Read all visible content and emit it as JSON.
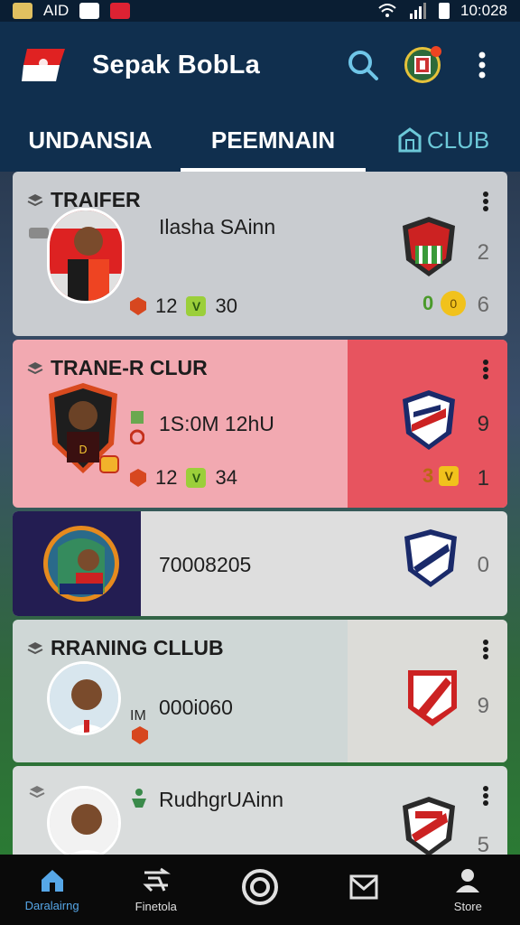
{
  "status_bar": {
    "carrier": "AID",
    "time": "10:028"
  },
  "app_bar": {
    "title": "Sepak BobLa"
  },
  "tabs": [
    {
      "label": "UNDANSIA",
      "active": false
    },
    {
      "label": "PEEMNAIN",
      "active": true
    },
    {
      "label": "CLUB",
      "active": false
    }
  ],
  "cards": [
    {
      "section": "TRAIFER",
      "player_name": "Ilasha SAinn",
      "stat_1": "12",
      "stat_2": "30",
      "right_small": "0",
      "side_number": "2",
      "side_number_2": "6"
    },
    {
      "section": "TRANE-R CLUR",
      "player_name": "1S:0M 12hU",
      "stat_1": "12",
      "stat_2": "34",
      "right_small": "3",
      "side_number": "9",
      "side_number_2": "1"
    },
    {
      "section": "",
      "player_name": "70008205",
      "side_number": "0"
    },
    {
      "section": "RRANING CLLUB",
      "player_name": "000i060",
      "side_label": "IM",
      "side_number": "9"
    },
    {
      "section": "",
      "player_name": "RudhgrUAinn",
      "side_number": "5"
    }
  ],
  "bottom_nav": [
    {
      "label": "Daralairng",
      "icon": "home-icon",
      "active": true
    },
    {
      "label": "Finetola",
      "icon": "transfer-icon",
      "active": false
    },
    {
      "label": "",
      "icon": "ball-icon",
      "active": false
    },
    {
      "label": "",
      "icon": "mail-icon",
      "active": false
    },
    {
      "label": "Store",
      "icon": "profile-icon",
      "active": false
    }
  ],
  "colors": {
    "primary": "#102f4e",
    "pink_card": "#f2a9b1",
    "accent_red": "#e7545f",
    "tab_club": "#6cc8d8",
    "nav_active": "#56a7e8"
  }
}
